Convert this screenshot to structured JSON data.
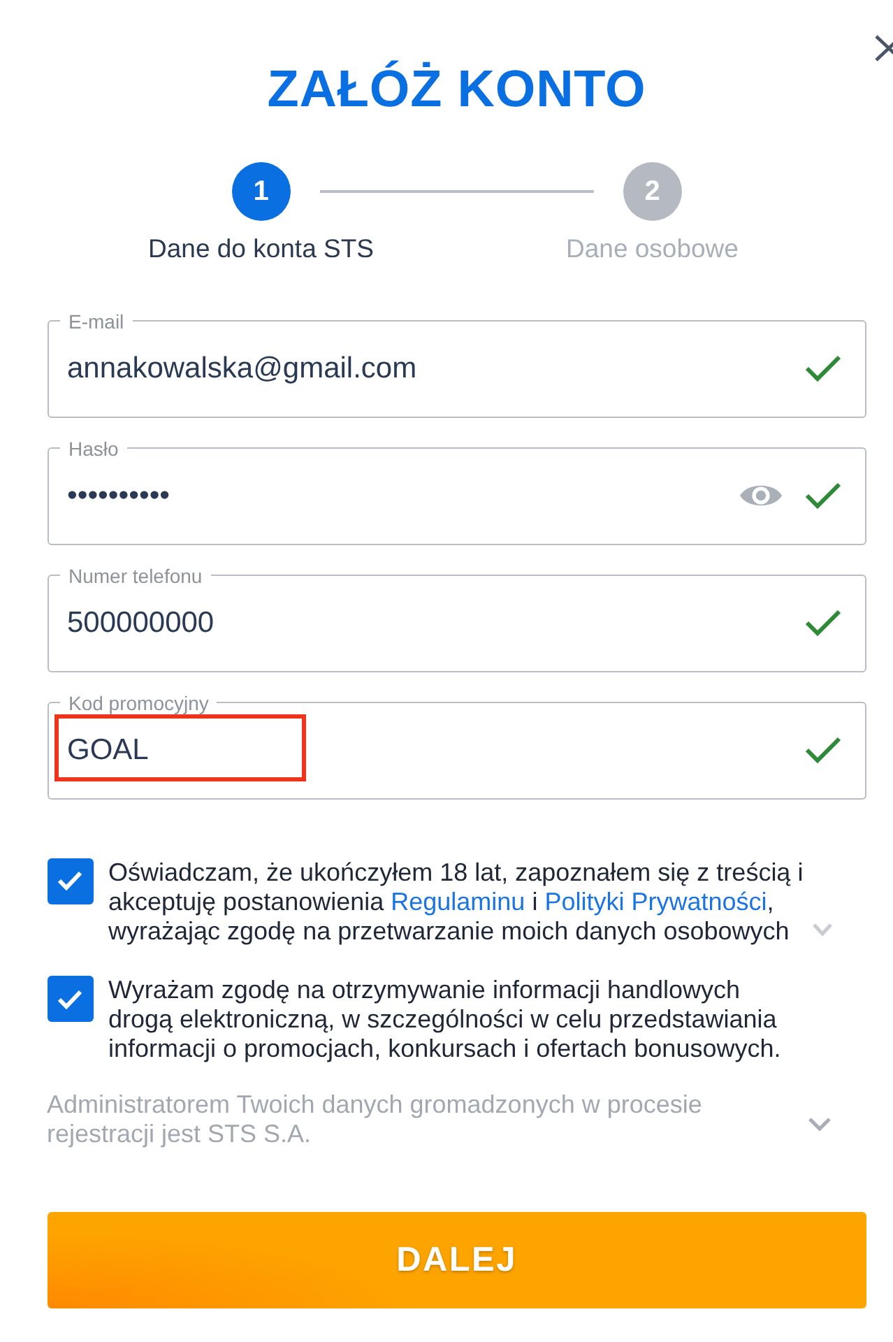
{
  "title": "ZAŁÓŻ KONTO",
  "steps": [
    {
      "number": "1",
      "label": "Dane do konta STS",
      "selected": true
    },
    {
      "number": "2",
      "label": "Dane osobowe",
      "selected": false
    }
  ],
  "fields": [
    {
      "kind": "email",
      "label": "E-mail",
      "value": "annakowalska@gmail.com",
      "valid": true,
      "highlighted": false
    },
    {
      "kind": "password",
      "label": "Hasło",
      "value": "••••••••••",
      "valid": true,
      "highlighted": false
    },
    {
      "kind": "phone",
      "label": "Numer telefonu",
      "value": "500000000",
      "valid": true,
      "highlighted": false
    },
    {
      "kind": "promo",
      "label": "Kod promocyjny",
      "value": "GOAL",
      "valid": true,
      "highlighted": true
    }
  ],
  "consents": [
    {
      "checked": true,
      "expanded": false,
      "segments": [
        {
          "kind": "text",
          "text": "Oświadczam, że ukończyłem 18 lat, zapoznałem się z treścią i akceptuję postanowienia "
        },
        {
          "kind": "link",
          "text": "Regulaminu"
        },
        {
          "kind": "text",
          "text": " i "
        },
        {
          "kind": "link",
          "text": "Polityki Prywatności"
        },
        {
          "kind": "text",
          "text": ", wyrażając zgodę na przetwarzanie moich danych osobowych"
        }
      ]
    },
    {
      "checked": true,
      "segments": [
        {
          "kind": "text",
          "text": "Wyrażam zgodę na otrzymywanie informacji handlowych drogą elektroniczną, w szczególności w celu przedstawiania informacji o promocjach, konkursach i ofertach bonusowych."
        }
      ]
    }
  ],
  "info": {
    "text": "Administratorem Twoich danych gromadzonych w procesie rejestracji jest STS S.A.",
    "expanded": false
  },
  "submit_button": "DALEJ"
}
